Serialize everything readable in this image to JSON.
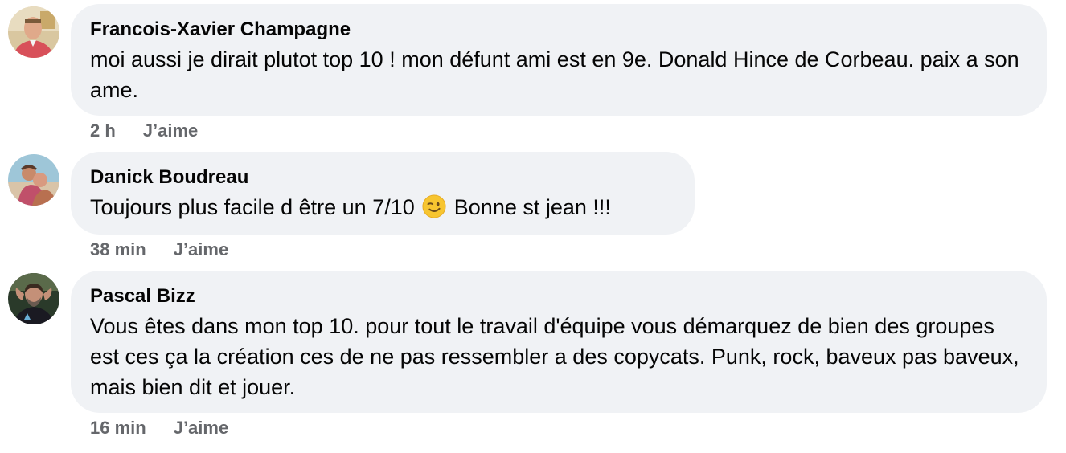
{
  "comments": [
    {
      "author": "Francois-Xavier Champagne",
      "text": "moi aussi je dirait plutot top 10 ! mon défunt ami est en 9e. Donald Hince de Corbeau. paix a son ame.",
      "time": "2 h",
      "like_label": "J’aime"
    },
    {
      "author": "Danick Boudreau",
      "text_before_emoji": "Toujours plus facile d être un 7/10",
      "emoji": "winking-face",
      "text_after_emoji": "Bonne st jean !!!",
      "time": "38 min",
      "like_label": "J’aime"
    },
    {
      "author": "Pascal Bizz",
      "text": "Vous êtes dans mon top 10. pour tout le travail d'équipe vous démarquez de bien des groupes est ces ça la création ces de ne pas ressembler a des copycats. Punk, rock, baveux pas baveux, mais bien dit et jouer.",
      "time": "16 min",
      "like_label": "J’aime"
    }
  ],
  "colors": {
    "bubble": "#f0f2f5",
    "meta_text": "#65676b",
    "text": "#050505"
  }
}
